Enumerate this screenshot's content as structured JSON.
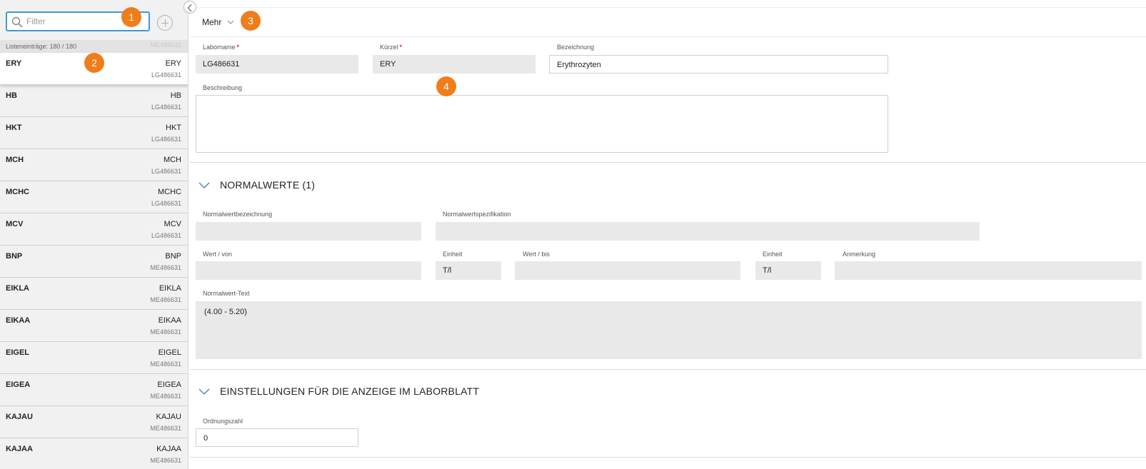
{
  "sidebar": {
    "filter": {
      "placeholder": "Filter",
      "value": ""
    },
    "add_button": "add",
    "count_text": "Listeneinträge: 180 / 180",
    "ghost_code": "ME486631",
    "items": [
      {
        "left": "ERY",
        "right": "ERY",
        "sub": "LG486631",
        "selected": true
      },
      {
        "left": "HB",
        "right": "HB",
        "sub": "LG486631"
      },
      {
        "left": "HKT",
        "right": "HKT",
        "sub": "LG486631"
      },
      {
        "left": "MCH",
        "right": "MCH",
        "sub": "LG486631"
      },
      {
        "left": "MCHC",
        "right": "MCHC",
        "sub": "LG486631"
      },
      {
        "left": "MCV",
        "right": "MCV",
        "sub": "LG486631"
      },
      {
        "left": "BNP",
        "right": "BNP",
        "sub": "ME486631"
      },
      {
        "left": "EIKLA",
        "right": "EIKLA",
        "sub": "ME486631"
      },
      {
        "left": "EIKAA",
        "right": "EIKAA",
        "sub": "ME486631"
      },
      {
        "left": "EIGEL",
        "right": "EIGEL",
        "sub": "ME486631"
      },
      {
        "left": "EIGEA",
        "right": "EIGEA",
        "sub": "ME486631"
      },
      {
        "left": "KAJAU",
        "right": "KAJAU",
        "sub": "ME486631"
      },
      {
        "left": "KAJAA",
        "right": "KAJAA",
        "sub": "ME486631"
      }
    ]
  },
  "toolbar": {
    "more_label": "Mehr"
  },
  "form": {
    "laborname": {
      "label": "Laborname",
      "required": "*",
      "value": "LG486631"
    },
    "kuerzel": {
      "label": "Kürzel",
      "required": "*",
      "value": "ERY"
    },
    "bezeichnung": {
      "label": "Bezeichnung",
      "value": "Erythrozyten"
    },
    "beschreibung": {
      "label": "Beschreibung",
      "value": ""
    }
  },
  "normalwerte": {
    "title": "NORMALWERTE (1)",
    "bezeichnung_label": "Normalwertbezeichnung",
    "bezeichnung_value": "",
    "spezifikation_label": "Normalwertspezifikation",
    "spezifikation_value": "",
    "wert_von_label": "Wert / von",
    "wert_von_value": "",
    "einheit1_label": "Einheit",
    "einheit1_value": "T/l",
    "wert_bis_label": "Wert / bis",
    "wert_bis_value": "",
    "einheit2_label": "Einheit",
    "einheit2_value": "T/l",
    "anmerkung_label": "Anmerkung",
    "anmerkung_value": "",
    "text_label": "Normalwert-Text",
    "text_value": "(4.00 - 5.20)"
  },
  "einstellungen": {
    "title": "EINSTELLUNGEN FÜR DIE ANZEIGE IM LABORBLATT",
    "ordnungszahl_label": "Ordnungszahl",
    "ordnungszahl_value": "0"
  },
  "badges": [
    "1",
    "2",
    "3",
    "4"
  ],
  "colors": {
    "accent": "#3f9ad8",
    "badge": "#ef7d1a",
    "required": "#d23a3a"
  }
}
